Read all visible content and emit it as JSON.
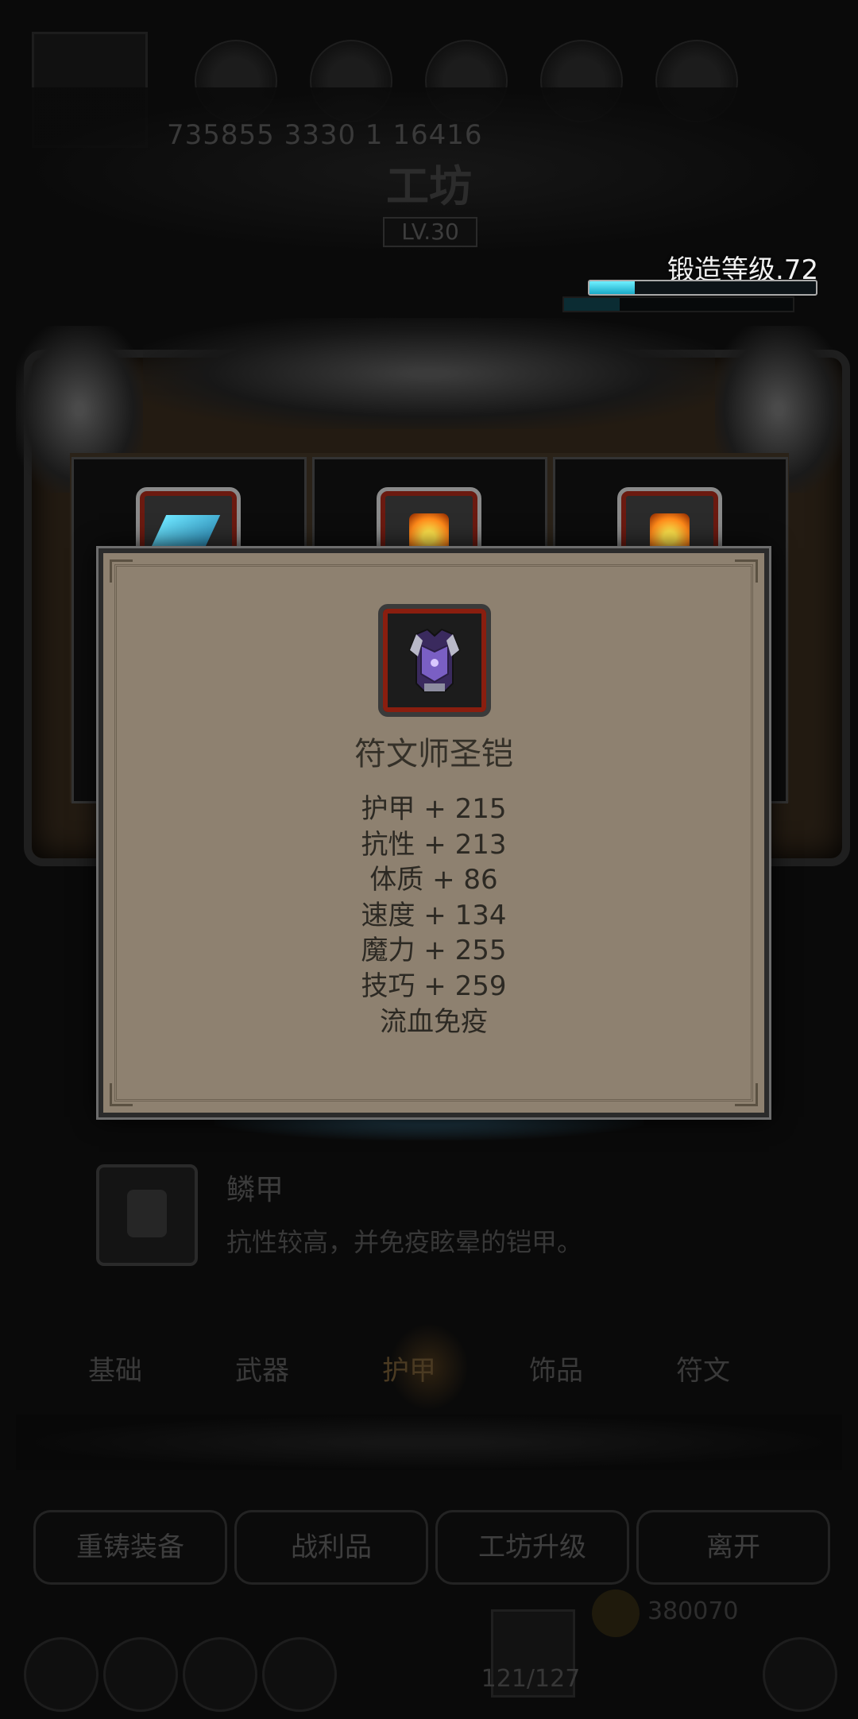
{
  "header": {
    "stats_row": "735855   3330   1   16416",
    "title": "工坊",
    "level": "LV.30"
  },
  "forge": {
    "label": "锻造等级.72",
    "progress": 0.2
  },
  "recipe": {
    "name": "鳞甲",
    "description": "抗性较高，并免疫眩晕的铠甲。"
  },
  "tabs": [
    {
      "label": "基础"
    },
    {
      "label": "武器"
    },
    {
      "label": "护甲",
      "active": true
    },
    {
      "label": "饰品"
    },
    {
      "label": "符文"
    }
  ],
  "buttons": {
    "reforge": "重铸装备",
    "loot": "战利品",
    "upgrade": "工坊升级",
    "leave": "离开"
  },
  "footer": {
    "chest_count": "121/127",
    "gold": "380070"
  },
  "tooltip": {
    "item_name": "符文师圣铠",
    "stats": [
      "护甲 + 215",
      "抗性 + 213",
      "体质 + 86",
      "速度 + 134",
      "魔力 + 255",
      "技巧 + 259",
      "流血免疫"
    ]
  },
  "colors": {
    "accent": "#2ec7e0",
    "tooltip_bg": "#8e8170",
    "item_frame": "#8a1e0f"
  },
  "icons": {
    "tooltip_item": "armor-icon",
    "material_1": "crystal-icon",
    "material_2": "rune-icon",
    "material_3": "rune-icon"
  }
}
